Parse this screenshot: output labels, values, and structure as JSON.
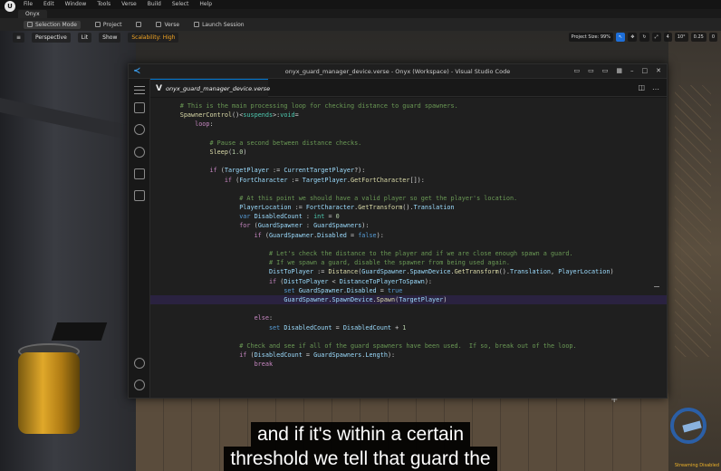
{
  "unreal": {
    "logo": "U",
    "menu": [
      "File",
      "Edit",
      "Window",
      "Tools",
      "Verse",
      "Build",
      "Select",
      "Help"
    ],
    "project_tab": "Onyx",
    "toolbar": {
      "selection_mode": "Selection Mode",
      "project": "Project",
      "verse": "Verse",
      "launch_session": "Launch Session"
    },
    "viewport": {
      "perspective": "Perspective",
      "lit": "Lit",
      "show": "Show",
      "scalability": "Scalability: High",
      "project_size": "Project Size: 99%",
      "grid_value": "4",
      "rotation_value": "10°",
      "scale_value": "0.25",
      "camera_value": "0",
      "streaming": "Streaming Disabled"
    }
  },
  "vscode": {
    "window_title": "onyx_guard_manager_device.verse - Onyx (Workspace) - Visual Studio Code",
    "tab_label": "onyx_guard_manager_device.verse",
    "tab_icon": "V",
    "activity_icons": [
      "menu-icon",
      "files-icon",
      "search-icon",
      "source-control-icon",
      "run-debug-icon",
      "extensions-icon",
      "account-icon",
      "settings-gear-icon"
    ],
    "code": [
      "        # This is the main processing loop for checking distance to guard spawners.",
      "        SpawnerControl()<suspends>:void=",
      "            loop:",
      "",
      "                # Pause a second between distance checks.",
      "                Sleep(1.0)",
      "",
      "                if (TargetPlayer := CurrentTargetPlayer?):",
      "                    if (FortCharacter := TargetPlayer.GetFortCharacter[]):",
      "",
      "                        # At this point we should have a valid player so get the player's location.",
      "                        PlayerLocation := FortCharacter.GetTransform().Translation",
      "                        var DisabledCount : int = 0",
      "                        for (GuardSpawner : GuardSpawners):",
      "                            if (GuardSpawner.Disabled = false):",
      "",
      "                                # Let's check the distance to the player and if we are close enough spawn a guard.",
      "                                # If we spawn a guard, disable the spawner from being used again.",
      "                                DistToPlayer := Distance(GuardSpawner.SpawnDevice.GetTransform().Translation, PlayerLocation)",
      "                                if (DistToPlayer < DistanceToPlayerToSpawn):",
      "                                    set GuardSpawner.Disabled = true",
      "                                    GuardSpawner.SpawnDevice.Spawn(TargetPlayer)",
      "",
      "                            else:",
      "                                set DisabledCount = DisabledCount + 1",
      "",
      "                        # Check and see if all of the guard spawners have been used.  If so, break out of the loop.",
      "                        if (DisabledCount = GuardSpawners.Length):",
      "                            break"
    ],
    "highlighted_line": 21
  },
  "subtitles": {
    "line1": "and if it's within a certain",
    "line2": "threshold we tell that guard the"
  }
}
